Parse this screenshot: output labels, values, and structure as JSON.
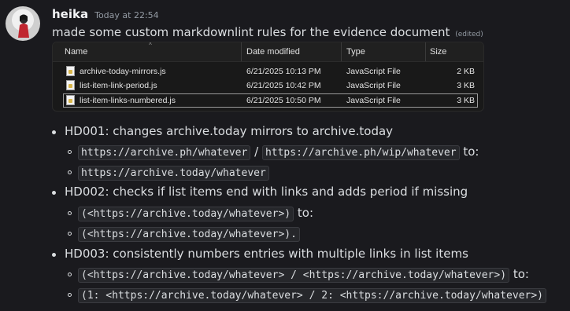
{
  "message": {
    "username": "heika",
    "timestamp": "Today at 22:54",
    "text": "made some custom markdownlint rules for the evidence document",
    "edited": "(edited)"
  },
  "explorer": {
    "columns": [
      "Name",
      "Date modified",
      "Type",
      "Size"
    ],
    "rows": [
      {
        "name": "archive-today-mirrors.js",
        "date": "6/21/2025 10:13 PM",
        "type": "JavaScript File",
        "size": "2 KB"
      },
      {
        "name": "list-item-link-period.js",
        "date": "6/21/2025 10:42 PM",
        "type": "JavaScript File",
        "size": "3 KB"
      },
      {
        "name": "list-item-links-numbered.js",
        "date": "6/21/2025 10:50 PM",
        "type": "JavaScript File",
        "size": "3 KB"
      }
    ]
  },
  "rules": [
    {
      "text": "HD001: changes archive.today mirrors to archive.today",
      "a1": "https://archive.ph/whatever",
      "sep": "/",
      "a2": "https://archive.ph/wip/whatever",
      "to": "to:",
      "b": "https://archive.today/whatever"
    },
    {
      "text": "HD002: checks if list items end with links and adds period if missing",
      "a": "(<https://archive.today/whatever>)",
      "to": "to:",
      "b": "(<https://archive.today/whatever>)."
    },
    {
      "text": "HD003: consistently numbers entries with multiple links in list items",
      "a": "(<https://archive.today/whatever> / <https://archive.today/whatever>)",
      "to": "to:",
      "b": "(1: <https://archive.today/whatever> / 2: <https://archive.today/whatever>)"
    }
  ],
  "colors": {
    "background": "#1a1a1e",
    "text": "#dbdee1",
    "muted": "#949ba4",
    "code_bg": "#26272b"
  }
}
